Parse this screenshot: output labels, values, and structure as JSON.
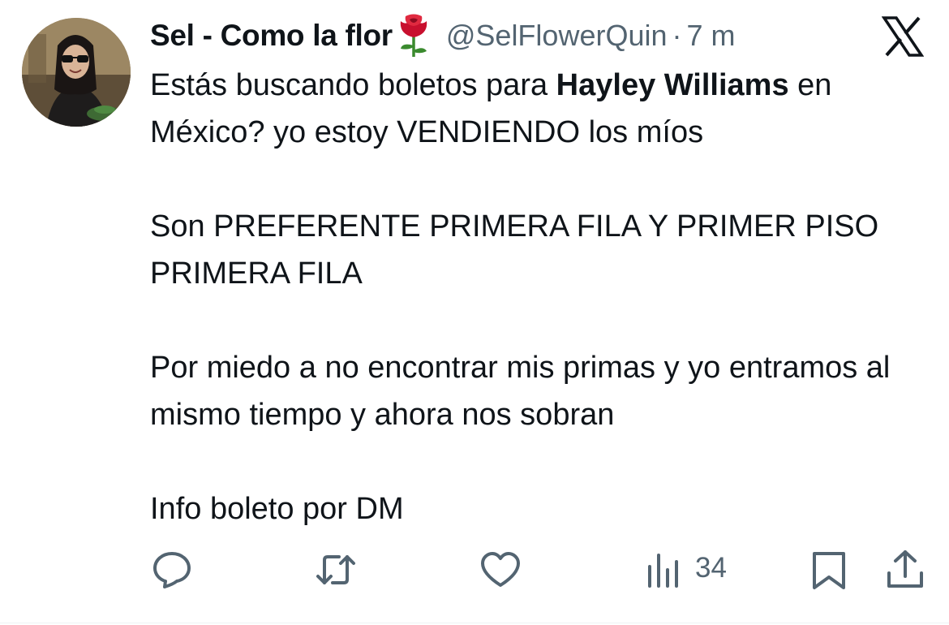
{
  "tweet": {
    "display_name": "Sel - Como la flor",
    "name_emoji": "rose-icon",
    "handle": "@SelFlowerQuin",
    "separator": "·",
    "time": "7 m",
    "text_intro": "Estás buscando boletos para ",
    "text_bold": "Hayley Williams",
    "text_rest": " en México? yo estoy VENDIENDO los míos\n\nSon PREFERENTE PRIMERA FILA Y PRIMER PISO PRIMERA FILA\n\nPor miedo a no encontrar mis primas y yo entramos al mismo tiempo y ahora nos sobran\n\nInfo boleto por DM"
  },
  "actions": {
    "views": "34"
  },
  "icons": [
    "x-logo-icon",
    "reply-icon",
    "retweet-icon",
    "like-icon",
    "views-icon",
    "bookmark-icon",
    "share-icon"
  ],
  "colors": {
    "text": "#0f1419",
    "secondary": "#536471",
    "rose_red": "#c8102e",
    "rose_green": "#3a8a2e"
  }
}
